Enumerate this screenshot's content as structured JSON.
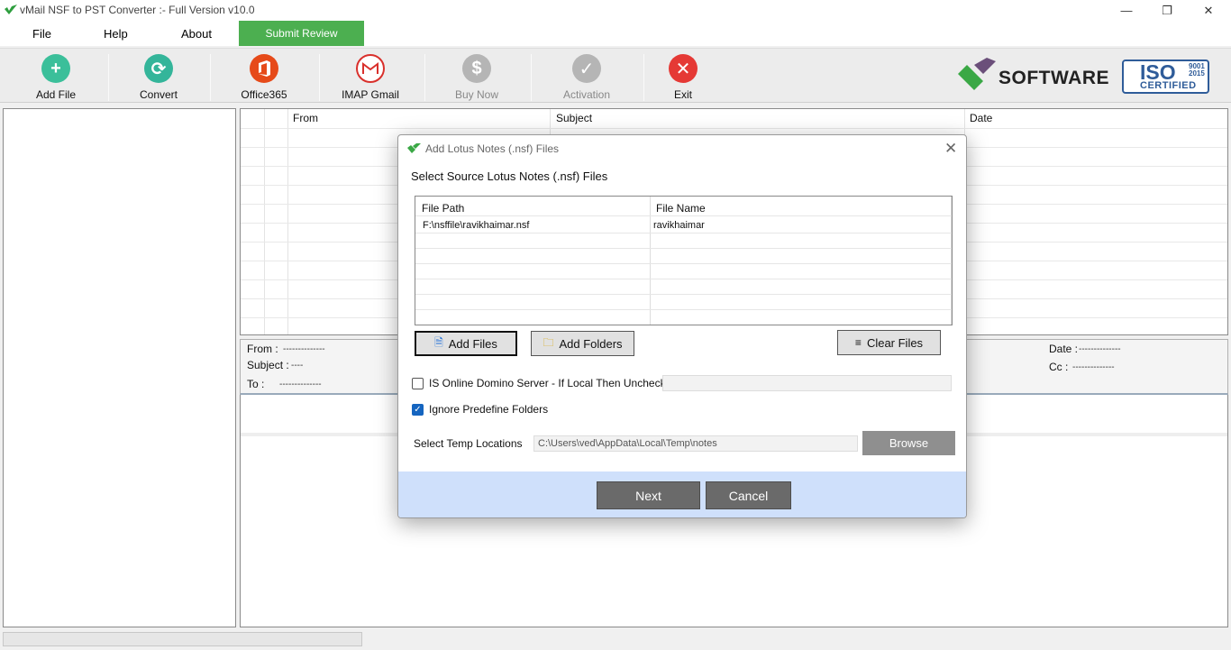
{
  "window": {
    "title": "vMail NSF to PST Converter :- Full Version v10.0",
    "minimize": "—",
    "restore": "❐",
    "close": "✕"
  },
  "menu": {
    "file": "File",
    "help": "Help",
    "about": "About",
    "submit_review": "Submit Review"
  },
  "toolbar": {
    "add_file": "Add File",
    "convert": "Convert",
    "office365": "Office365",
    "imap_gmail": "IMAP Gmail",
    "buy_now": "Buy Now",
    "activation": "Activation",
    "exit": "Exit"
  },
  "brand": {
    "name": "SOFTWARE",
    "iso": "ISO",
    "iso_years_1": "9001",
    "iso_years_2": "2015",
    "certified": "CERTIFIED"
  },
  "list": {
    "columns": [
      "From",
      "Subject",
      "Date"
    ]
  },
  "preview": {
    "from_label": "From :",
    "from_value": "--------------",
    "subject_label": "Subject :",
    "subject_value": "----",
    "to_label": "To :",
    "to_value": "--------------",
    "date_label": "Date :",
    "date_value": "--------------",
    "cc_label": "Cc :",
    "cc_value": "--------------"
  },
  "dialog": {
    "title": "Add Lotus Notes (.nsf) Files",
    "close": "✕",
    "subtitle": "Select Source Lotus Notes (.nsf) Files",
    "grid": {
      "columns": [
        "File Path",
        "File Name"
      ],
      "rows": [
        {
          "path": "F:\\nsffile\\ravikhaimar.nsf",
          "name": "ravikhaimar"
        }
      ]
    },
    "add_files": "Add Files",
    "add_folders": "Add Folders",
    "clear_files": "Clear Files",
    "online_domino_label": "IS Online Domino Server - If Local Then Unchecked",
    "online_domino_checked": false,
    "ignore_folders_label": "Ignore Predefine Folders",
    "ignore_folders_checked": true,
    "temp_label": "Select Temp Locations",
    "temp_value": "C:\\Users\\ved\\AppData\\Local\\Temp\\notes",
    "browse": "Browse",
    "next": "Next",
    "cancel": "Cancel"
  }
}
